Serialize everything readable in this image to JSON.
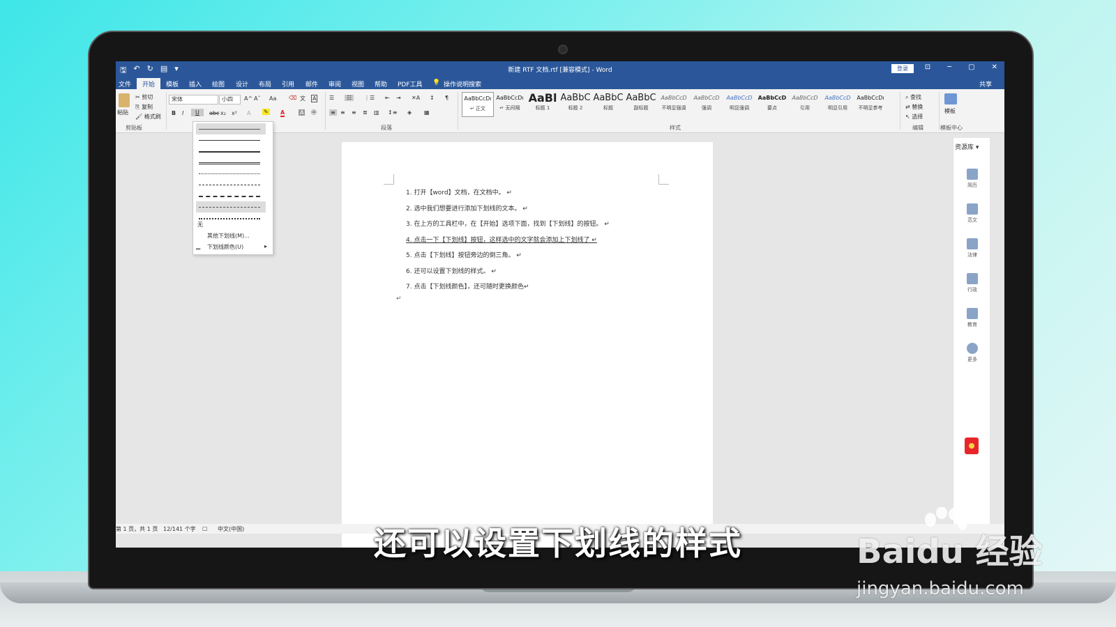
{
  "titlebar": {
    "title": "新建 RTF 文档.rtf [兼容模式] - Word",
    "signin": "登录",
    "qa_icons": [
      "save-icon",
      "undo-icon",
      "redo-icon",
      "print-preview-icon",
      "customize-icon"
    ],
    "win": {
      "ribbon_opt": "⊡",
      "min": "─",
      "max": "▢",
      "close": "✕"
    }
  },
  "tabs": [
    "文件",
    "开始",
    "模板",
    "插入",
    "绘图",
    "设计",
    "布局",
    "引用",
    "邮件",
    "审阅",
    "视图",
    "帮助",
    "PDF工具"
  ],
  "tell_me": "操作说明搜索",
  "share": "共享",
  "ribbon": {
    "clipboard": {
      "paste": "粘贴",
      "cut": "剪切",
      "copy": "复制",
      "format_painter": "格式刷",
      "label": "剪贴板"
    },
    "font": {
      "name": "宋体",
      "size": "小四",
      "bold": "B",
      "italic": "I",
      "underline": "U",
      "strike": "abc",
      "sub": "x₂",
      "sup": "x²",
      "grow": "A^",
      "shrink": "Aˇ",
      "case": "Aa",
      "color": "A"
    },
    "paragraph_label": "段落",
    "styles_label": "样式",
    "styles": [
      {
        "sample": "AaBbCcDı",
        "name": "↵ 正文"
      },
      {
        "sample": "AaBbCcDı",
        "name": "↵ 无间隔"
      },
      {
        "sample": "AaBl",
        "name": "标题 1"
      },
      {
        "sample": "AaBbC",
        "name": "标题 2"
      },
      {
        "sample": "AaBbC",
        "name": "标题"
      },
      {
        "sample": "AaBbC",
        "name": "副标题"
      },
      {
        "sample": "AaBbCcD",
        "name": "不明显强调"
      },
      {
        "sample": "AaBbCcD",
        "name": "强调"
      },
      {
        "sample": "AaBbCcD",
        "name": "明显强调"
      },
      {
        "sample": "AaBbCcD",
        "name": "要点"
      },
      {
        "sample": "AaBbCcD",
        "name": "引用"
      },
      {
        "sample": "AaBbCcD",
        "name": "明显引用"
      },
      {
        "sample": "AaBbCcDı",
        "name": "不明显参考"
      }
    ],
    "editing": {
      "find": "查找",
      "replace": "替换",
      "select": "选择",
      "label": "编辑"
    },
    "template": {
      "btn": "模板",
      "label": "模板中心"
    }
  },
  "underline_menu": {
    "none": "无",
    "more": "其他下划线(M)...",
    "color": "下划线颜色(U)"
  },
  "document": {
    "items": [
      "1.  打开【word】文档，在文档中。 ↵",
      "2.  选中我们想要进行添加下划线的文本。 ↵",
      "3.  在上方的工具栏中，在【开始】选项下面，找到【下划线】的按钮。 ↵",
      "4.  点击一下【下划线】按钮，这样选中的文字就会添加上下划线了 ↵",
      "5.  点击【下划线】按钮旁边的倒三角。 ↵",
      "6.  还可以设置下划线的样式。 ↵",
      "7.  点击【下划线颜色】，还可随时更换颜色↵"
    ],
    "trailing_mark": "↵"
  },
  "sidebar": {
    "header": "资源库 ▾",
    "items": [
      "简历",
      "范文",
      "法律",
      "行政",
      "教育",
      "更多"
    ]
  },
  "status": {
    "page": "第 1 页，共 1 页",
    "words": "12/141 个字",
    "lang": "中文(中国)"
  },
  "subtitle": "还可以设置下划线的样式",
  "watermark": {
    "brand": "Baidu 经验",
    "url": "jingyan.baidu.com"
  },
  "colors": {
    "word_blue": "#2b579a",
    "ribbon_bg": "#f3f3f3",
    "font_red": "#e02020",
    "highlight_yellow": "#f8e71c"
  }
}
